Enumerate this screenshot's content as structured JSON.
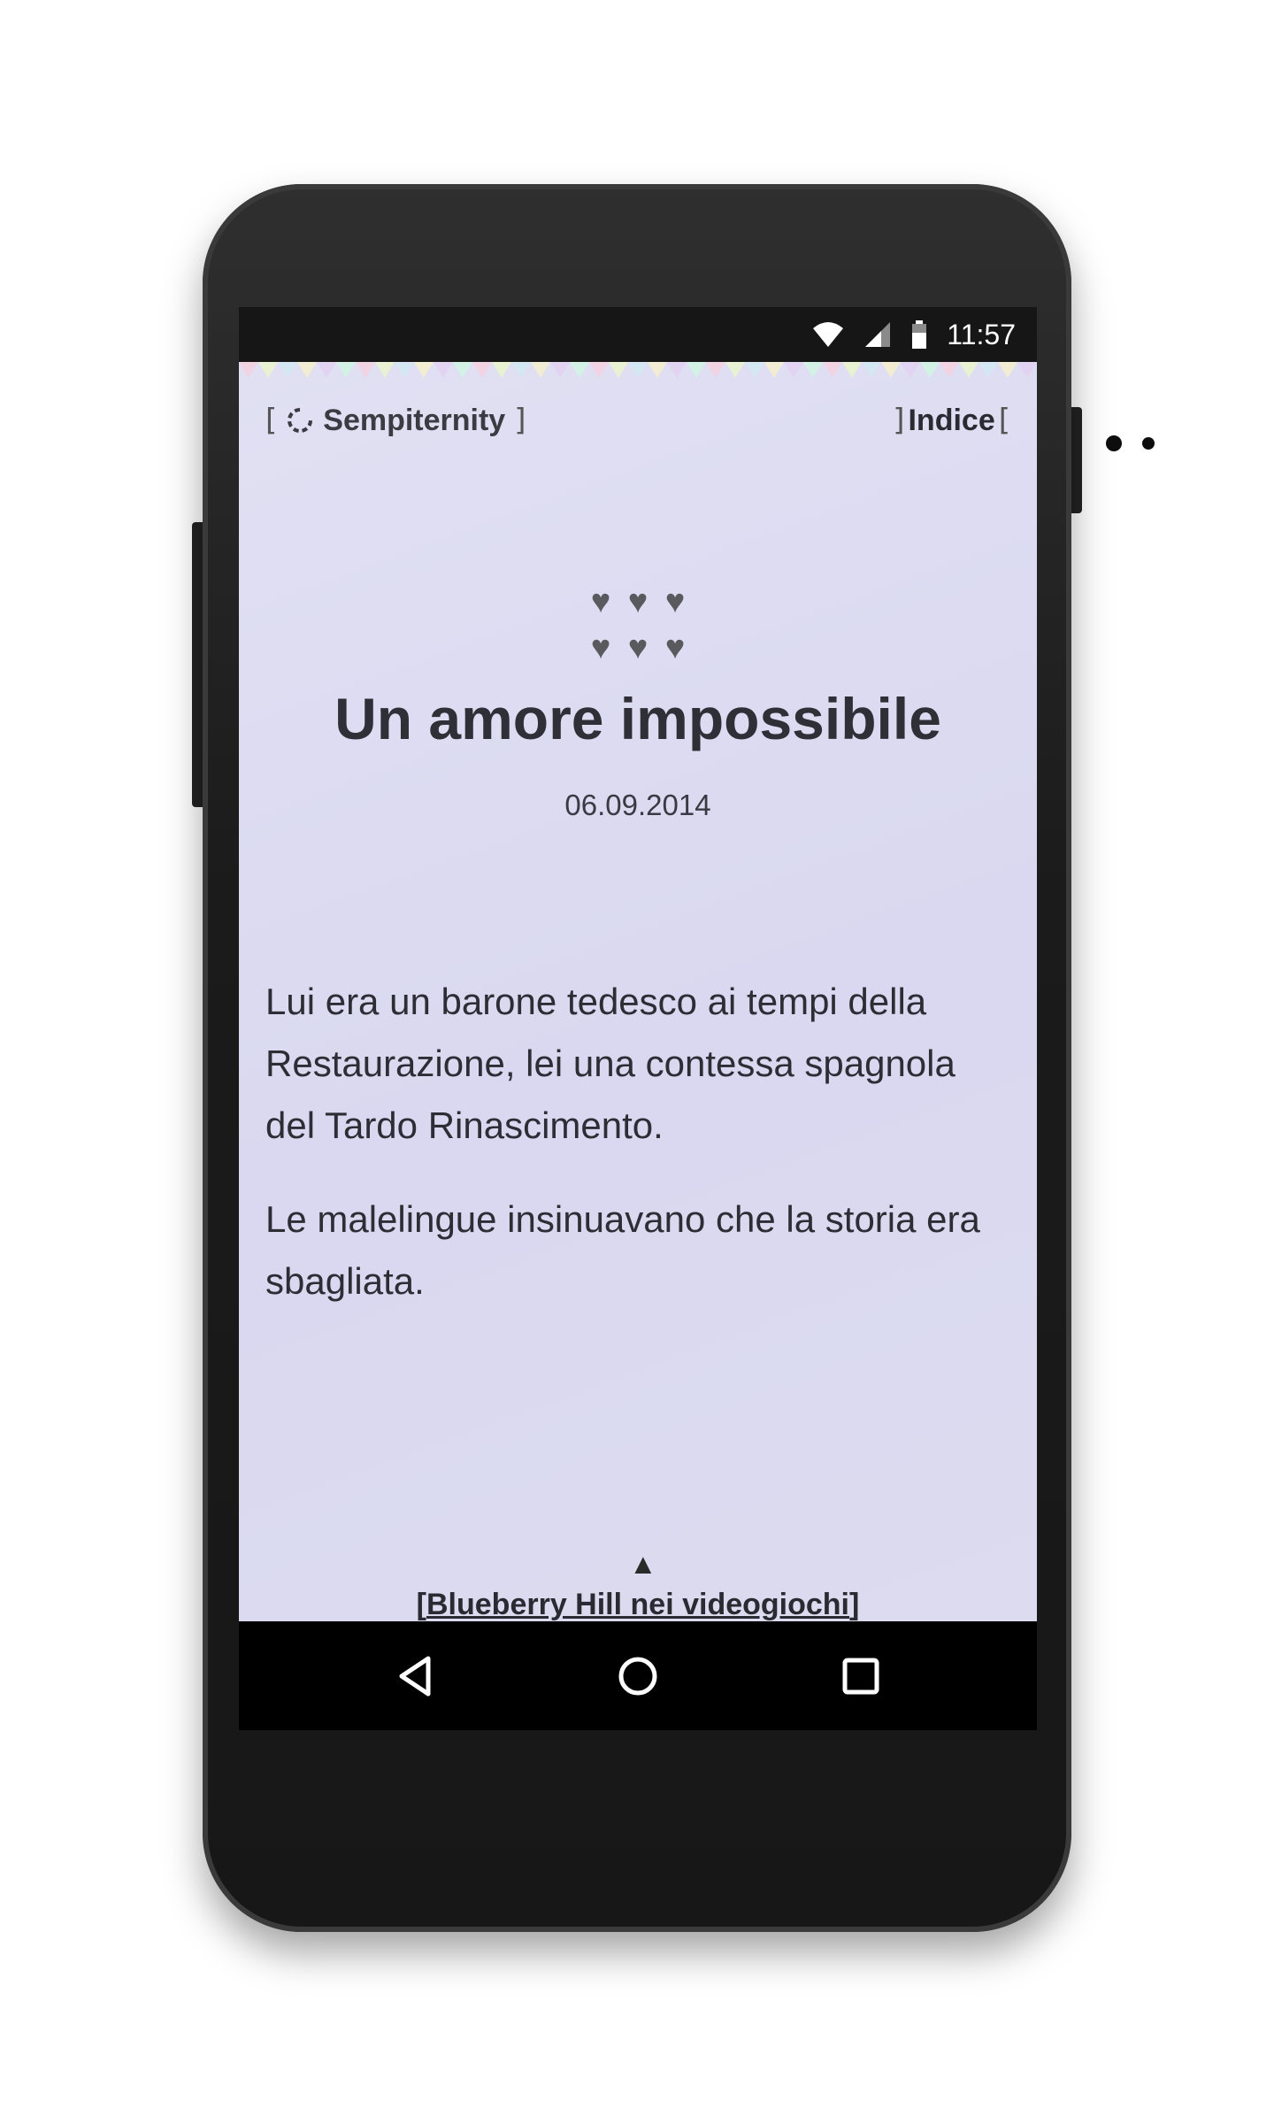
{
  "status_bar": {
    "time": "11:57",
    "icons": [
      "wifi-icon",
      "signal-icon",
      "battery-icon"
    ]
  },
  "header": {
    "site_name": "Sempiternity",
    "index_label": "Indice",
    "bracket_open": "[",
    "bracket_close": "]"
  },
  "post": {
    "hearts": [
      "♥",
      "♥",
      "♥",
      "♥",
      "♥",
      "♥"
    ],
    "title": "Un amore impossibile",
    "date": "06.09.2014",
    "paragraphs": [
      "Lui era un barone tedesco ai tempi della Restaurazione, lei una contessa spagnola del Tardo Rinascimento.",
      "Le malelingue insinuavano che la storia era sbagliata."
    ]
  },
  "footer": {
    "arrow": "▲",
    "next_post": "Blueberry Hill nei videogiochi"
  },
  "navigation_bar": {
    "buttons": [
      "back-icon",
      "home-icon",
      "recents-icon"
    ]
  },
  "colors": {
    "page_bg": "#dcdbf0",
    "text": "#2f2f38",
    "status_bar": "#161616",
    "nav_bar": "#000000"
  }
}
